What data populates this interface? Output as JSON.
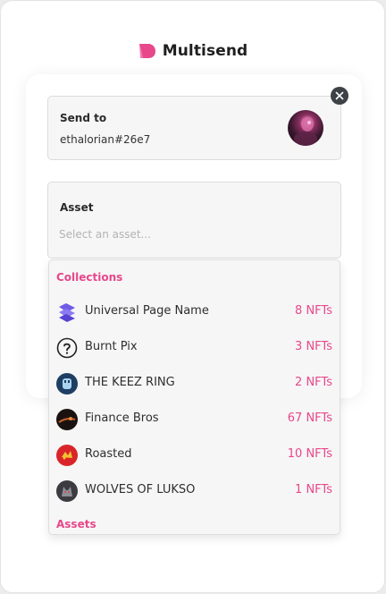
{
  "app": {
    "title": "Multisend",
    "logo_icon": "multisend-logo-icon",
    "accent_color": "#e8478b"
  },
  "send_to": {
    "label": "Send to",
    "value": "ethalorian#26e7",
    "avatar_icon": "profile-avatar"
  },
  "close_icon": "close-icon",
  "asset": {
    "label": "Asset",
    "placeholder": "Select an asset..."
  },
  "dropdown": {
    "collections_title": "Collections",
    "assets_title": "Assets",
    "collections": [
      {
        "name": "Universal Page Name",
        "count": "8 NFTs",
        "icon": "universal-page-icon"
      },
      {
        "name": "Burnt Pix",
        "count": "3 NFTs",
        "icon": "question-mark-icon"
      },
      {
        "name": "THE KEEZ RING",
        "count": "2 NFTs",
        "icon": "keez-ring-icon"
      },
      {
        "name": "Finance Bros",
        "count": "67 NFTs",
        "icon": "finance-bros-icon"
      },
      {
        "name": "Roasted",
        "count": "10 NFTs",
        "icon": "roasted-icon"
      },
      {
        "name": "WOLVES OF LUKSO",
        "count": "1 NFTs",
        "icon": "wolves-icon"
      }
    ]
  }
}
